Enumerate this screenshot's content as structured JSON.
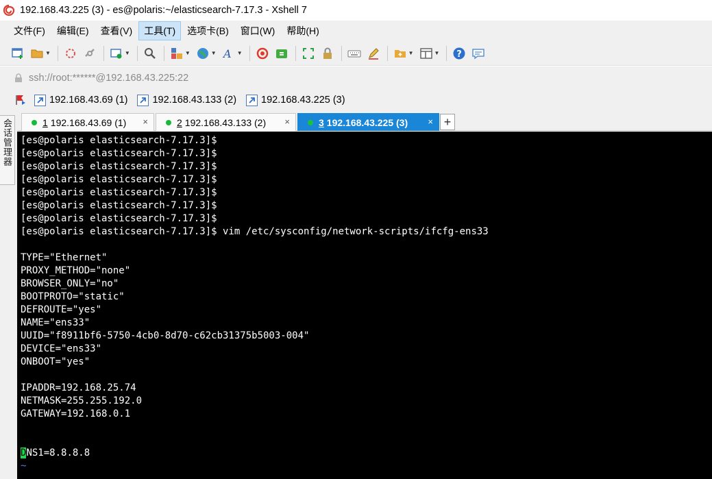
{
  "window": {
    "title": "192.168.43.225 (3) - es@polaris:~/elasticsearch-7.17.3 - Xshell 7"
  },
  "menu": [
    {
      "label": "文件(F)"
    },
    {
      "label": "编辑(E)"
    },
    {
      "label": "查看(V)"
    },
    {
      "label": "工具(T)",
      "active": true
    },
    {
      "label": "选项卡(B)"
    },
    {
      "label": "窗口(W)"
    },
    {
      "label": "帮助(H)"
    }
  ],
  "address": {
    "value": "ssh://root:******@192.168.43.225:22"
  },
  "links": [
    {
      "label": "192.168.43.69 (1)"
    },
    {
      "label": "192.168.43.133 (2)"
    },
    {
      "label": "192.168.43.225 (3)"
    }
  ],
  "side_tab": {
    "label": "会话管理器"
  },
  "tabs": [
    {
      "num": "1",
      "label": "192.168.43.69 (1)",
      "close": "×"
    },
    {
      "num": "2",
      "label": "192.168.43.133 (2)",
      "close": "×"
    },
    {
      "num": "3",
      "label": "192.168.43.225 (3)",
      "close": "×",
      "active": true
    }
  ],
  "tab_add": "+",
  "terminal": {
    "lines": [
      "[es@polaris elasticsearch-7.17.3]$",
      "[es@polaris elasticsearch-7.17.3]$",
      "[es@polaris elasticsearch-7.17.3]$",
      "[es@polaris elasticsearch-7.17.3]$",
      "[es@polaris elasticsearch-7.17.3]$",
      "[es@polaris elasticsearch-7.17.3]$",
      "[es@polaris elasticsearch-7.17.3]$",
      "[es@polaris elasticsearch-7.17.3]$ vim /etc/sysconfig/network-scripts/ifcfg-ens33",
      "",
      "TYPE=\"Ethernet\"",
      "PROXY_METHOD=\"none\"",
      "BROWSER_ONLY=\"no\"",
      "BOOTPROTO=\"static\"",
      "DEFROUTE=\"yes\"",
      "NAME=\"ens33\"",
      "UUID=\"f8911bf6-5750-4cb0-8d70-c62cb31375b5003-004\"",
      "DEVICE=\"ens33\"",
      "ONBOOT=\"yes\"",
      "",
      "IPADDR=192.168.25.74",
      "NETMASK=255.255.192.0",
      "GATEWAY=192.168.0.1",
      "",
      ""
    ],
    "cursor_char": "D",
    "cursor_rest": "NS1=8.8.8.8",
    "tilde": "~"
  },
  "colors": {
    "accent": "#1a86d8",
    "status_dot": "#16b93a",
    "cursor": "#1bd94a",
    "tilde": "#4c7ee6"
  }
}
